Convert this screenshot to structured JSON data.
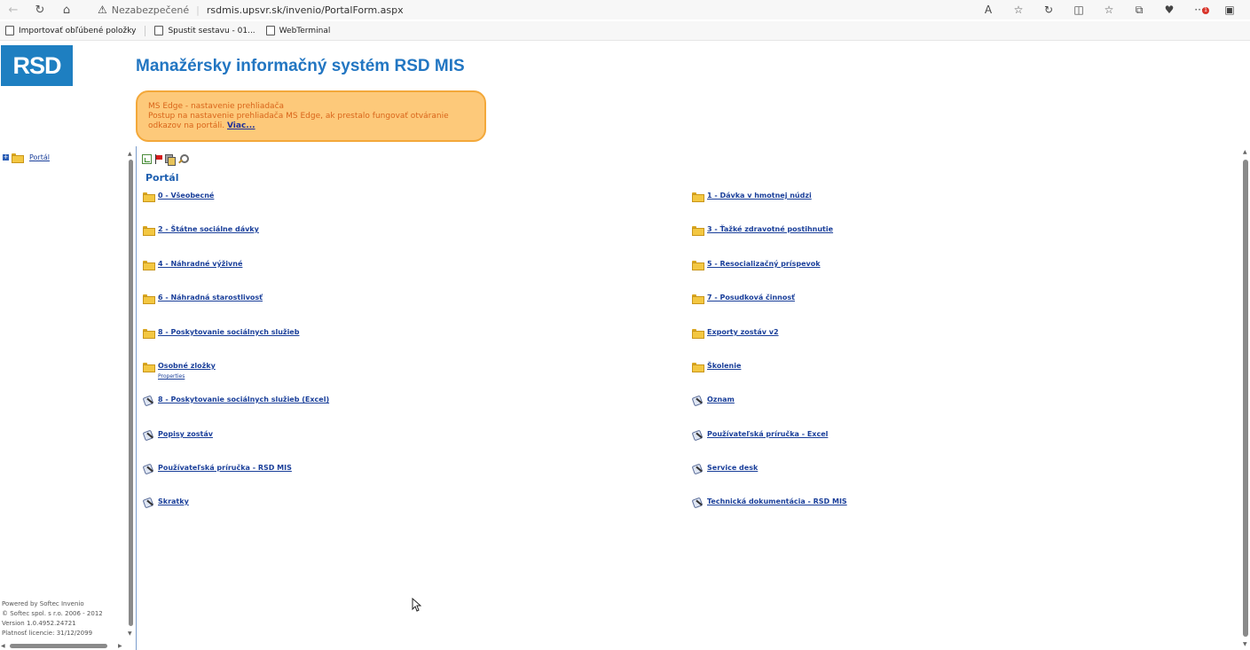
{
  "browser": {
    "security_status": "Nezabezpečené",
    "url": "rsdmis.upsvr.sk/invenio/PortalForm.aspx",
    "notification_count": "1"
  },
  "favorites": [
    {
      "label": "Importovať obľúbené položky"
    },
    {
      "label": "Spustit sestavu - 01..."
    },
    {
      "label": "WebTerminal"
    }
  ],
  "header": {
    "logo_text": "RSD",
    "title": "Manažérsky informačný systém RSD MIS"
  },
  "notice": {
    "title": "MS Edge - nastavenie prehliadača",
    "text": "Postup na nastavenie prehliadača MS Edge, ak prestalo fungovať otváranie odkazov na portáli.",
    "link": "Viac..."
  },
  "tree": {
    "expand": "+",
    "root": "Portál"
  },
  "footer": {
    "lines": [
      "Powered by Softec Invenio",
      "© Softec spol. s r.o. 2006 - 2012",
      "Version 1.0.4952.24721",
      "Platnosť licencie: 31/12/2099"
    ]
  },
  "content": {
    "section_title": "Portál",
    "left_items": [
      {
        "label": "0 - Všeobecné",
        "icon": "folder"
      },
      {
        "label": "2 - Štátne sociálne dávky",
        "icon": "folder"
      },
      {
        "label": "4 - Náhradné výživné",
        "icon": "folder"
      },
      {
        "label": "6 - Náhradná starostlivosť",
        "icon": "folder"
      },
      {
        "label": "8 - Poskytovanie sociálnych služieb",
        "icon": "folder"
      },
      {
        "label": "Osobné zložky",
        "icon": "folder",
        "sub": "Properties"
      },
      {
        "label": "8 - Poskytovanie sociálnych služieb (Excel)",
        "icon": "link"
      },
      {
        "label": "Popisy zostáv",
        "icon": "link"
      },
      {
        "label": "Používateľská príručka - RSD MIS",
        "icon": "link"
      },
      {
        "label": "Skratky",
        "icon": "link"
      }
    ],
    "right_items": [
      {
        "label": "1 - Dávka v hmotnej núdzi",
        "icon": "folder"
      },
      {
        "label": "3 - Ťažké zdravotné postihnutie",
        "icon": "folder"
      },
      {
        "label": "5 - Resocializačný príspevok",
        "icon": "folder"
      },
      {
        "label": "7 - Posudková činnosť",
        "icon": "folder"
      },
      {
        "label": "Exporty zostáv v2",
        "icon": "folder"
      },
      {
        "label": "Školenie",
        "icon": "folder"
      },
      {
        "label": "Oznam",
        "icon": "link"
      },
      {
        "label": "Používateľská príručka - Excel",
        "icon": "link"
      },
      {
        "label": "Service desk",
        "icon": "link"
      },
      {
        "label": "Technická dokumentácia - RSD MIS",
        "icon": "link"
      }
    ]
  }
}
